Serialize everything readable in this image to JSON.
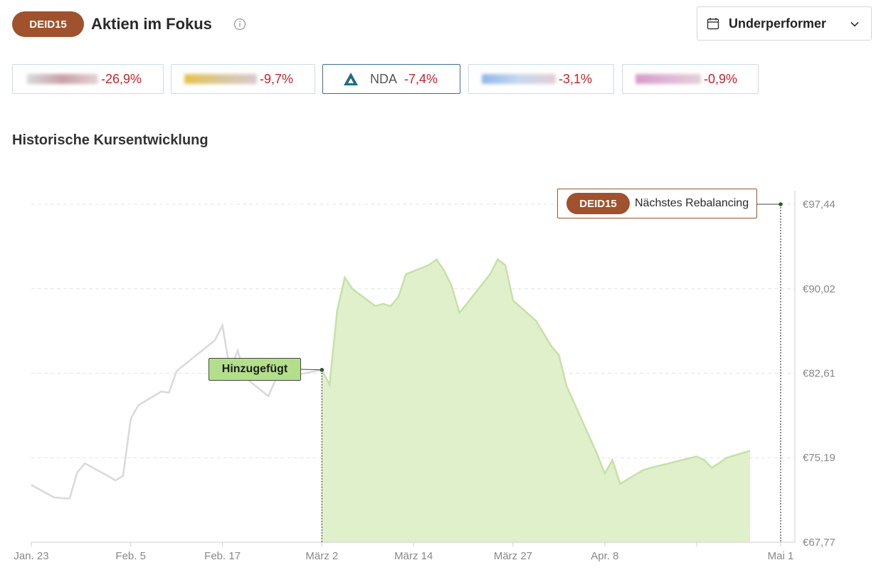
{
  "header": {
    "index_badge": "DEID15",
    "title": "Aktien im Fokus",
    "info_icon": "info-icon"
  },
  "filter": {
    "selected": "Underperformer",
    "icon": "calendar-icon"
  },
  "stocks": [
    {
      "change": "-26,9%",
      "logo_color": "#c9a0a8"
    },
    {
      "change": "-9,7%",
      "logo_color": "#e8c24a"
    },
    {
      "symbol": "NDA",
      "change": "-7,4%",
      "logo_color": "#1c6e86",
      "active": true
    },
    {
      "change": "-3,1%",
      "logo_color": "#8fb8ea"
    },
    {
      "change": "-0,9%",
      "logo_color": "#d79bc8"
    }
  ],
  "section_title": "Historische Kursentwicklung",
  "annotations": {
    "added_label": "Hinzugefügt",
    "rebalancing_badge": "DEID15",
    "rebalancing_text": "Nächstes Rebalancing"
  },
  "colors": {
    "accent": "#a0512d",
    "negative": "#c8232c",
    "area_fill": "#dff0cb",
    "area_line": "#c8e0a8",
    "pre_line": "#d9d9d9"
  },
  "chart_data": {
    "type": "area",
    "y_ticks": [
      "€97,44",
      "€90,02",
      "€82,61",
      "€75,19",
      "€67,77"
    ],
    "y_tick_values": [
      97.44,
      90.02,
      82.61,
      75.19,
      67.77
    ],
    "ylim": [
      67.77,
      97.44
    ],
    "x_ticks": [
      "Jan. 23",
      "Feb. 5",
      "Feb. 17",
      "März 2",
      "März 14",
      "März 27",
      "Apr. 8",
      "Mai 1"
    ],
    "added_date": "März 2",
    "rebalancing_value": 97.44,
    "series": [
      {
        "segment": "before",
        "points": [
          [
            "Jan. 23",
            72.8
          ],
          [
            "Jan. 26",
            71.7
          ],
          [
            "Jan. 28",
            71.6
          ],
          [
            "Jan. 29",
            73.9
          ],
          [
            "Jan. 30",
            74.7
          ],
          [
            "Feb. 2",
            73.6
          ],
          [
            "Feb. 3",
            73.2
          ],
          [
            "Feb. 4",
            73.6
          ],
          [
            "Feb. 5",
            78.6
          ],
          [
            "Feb. 6",
            79.8
          ],
          [
            "Feb. 9",
            81.0
          ],
          [
            "Feb. 10",
            80.9
          ],
          [
            "Feb. 11",
            82.8
          ],
          [
            "Feb. 16",
            85.5
          ],
          [
            "Feb. 17",
            86.8
          ],
          [
            "Feb. 18",
            82.8
          ],
          [
            "Feb. 19",
            84.6
          ],
          [
            "Feb. 20",
            82.2
          ],
          [
            "Feb. 23",
            80.6
          ],
          [
            "Feb. 24",
            82.1
          ],
          [
            "Feb. 25",
            82.4
          ],
          [
            "Feb. 26",
            82.2
          ],
          [
            "Feb. 27",
            82.5
          ],
          [
            "März 2",
            82.9
          ]
        ]
      },
      {
        "segment": "after",
        "points": [
          [
            "März 2",
            82.9
          ],
          [
            "März 3",
            81.6
          ],
          [
            "März 4",
            88.1
          ],
          [
            "März 5",
            91.0
          ],
          [
            "März 6",
            90.0
          ],
          [
            "März 9",
            88.5
          ],
          [
            "März 10",
            88.7
          ],
          [
            "März 11",
            88.5
          ],
          [
            "März 12",
            89.3
          ],
          [
            "März 13",
            91.3
          ],
          [
            "März 16",
            92.1
          ],
          [
            "März 17",
            92.6
          ],
          [
            "März 18",
            91.6
          ],
          [
            "März 19",
            90.2
          ],
          [
            "März 20",
            87.9
          ],
          [
            "März 24",
            91.3
          ],
          [
            "März 25",
            92.6
          ],
          [
            "März 26",
            92.1
          ],
          [
            "März 27",
            89.0
          ],
          [
            "März 30",
            87.2
          ],
          [
            "April 1",
            85.0
          ],
          [
            "April 2",
            84.2
          ],
          [
            "April 3",
            81.5
          ],
          [
            "April 6",
            77.0
          ],
          [
            "April 7",
            75.5
          ],
          [
            "April 8",
            73.8
          ],
          [
            "April 9",
            75.0
          ],
          [
            "April 10",
            72.9
          ],
          [
            "April 13",
            74.1
          ],
          [
            "April 14",
            74.3
          ],
          [
            "April 20",
            75.3
          ],
          [
            "April 21",
            75.0
          ],
          [
            "April 22",
            74.3
          ],
          [
            "April 24",
            75.2
          ],
          [
            "April 27",
            75.8
          ]
        ]
      }
    ],
    "grid": true,
    "grid_style": "dashed horizontal"
  }
}
